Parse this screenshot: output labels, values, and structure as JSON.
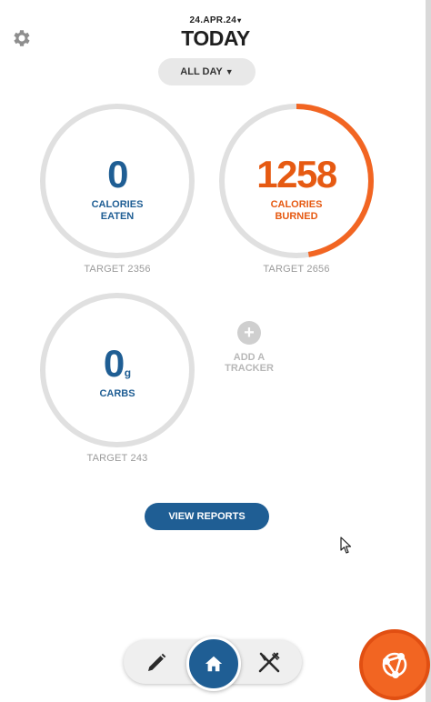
{
  "header": {
    "date": "24.APR.24",
    "date_caret": "▾",
    "title": "TODAY"
  },
  "period": {
    "label": "ALL DAY",
    "caret": "▼"
  },
  "trackers": {
    "calories_eaten": {
      "value": "0",
      "label_line1": "CALORIES",
      "label_line2": "EATEN",
      "target": "TARGET 2356",
      "progress": 0
    },
    "calories_burned": {
      "value": "1258",
      "label_line1": "CALORIES",
      "label_line2": "BURNED",
      "target": "TARGET 2656",
      "progress": 0.4737
    },
    "carbs": {
      "value": "0",
      "unit": "g",
      "label_line1": "CARBS",
      "target": "TARGET 243",
      "progress": 0
    }
  },
  "add_tracker": {
    "icon": "plus-icon",
    "label_line1": "ADD A",
    "label_line2": "TRACKER"
  },
  "actions": {
    "view_reports": "VIEW REPORTS"
  },
  "bottom_nav": {
    "left_icon": "pencil-icon",
    "center_icon": "home-icon",
    "right_icon": "fork-knife-icon",
    "fab_icon": "network-hub-icon"
  },
  "colors": {
    "brand_blue": "#1f5e94",
    "accent_orange": "#f26522",
    "ring_track": "#e0e0e0"
  }
}
